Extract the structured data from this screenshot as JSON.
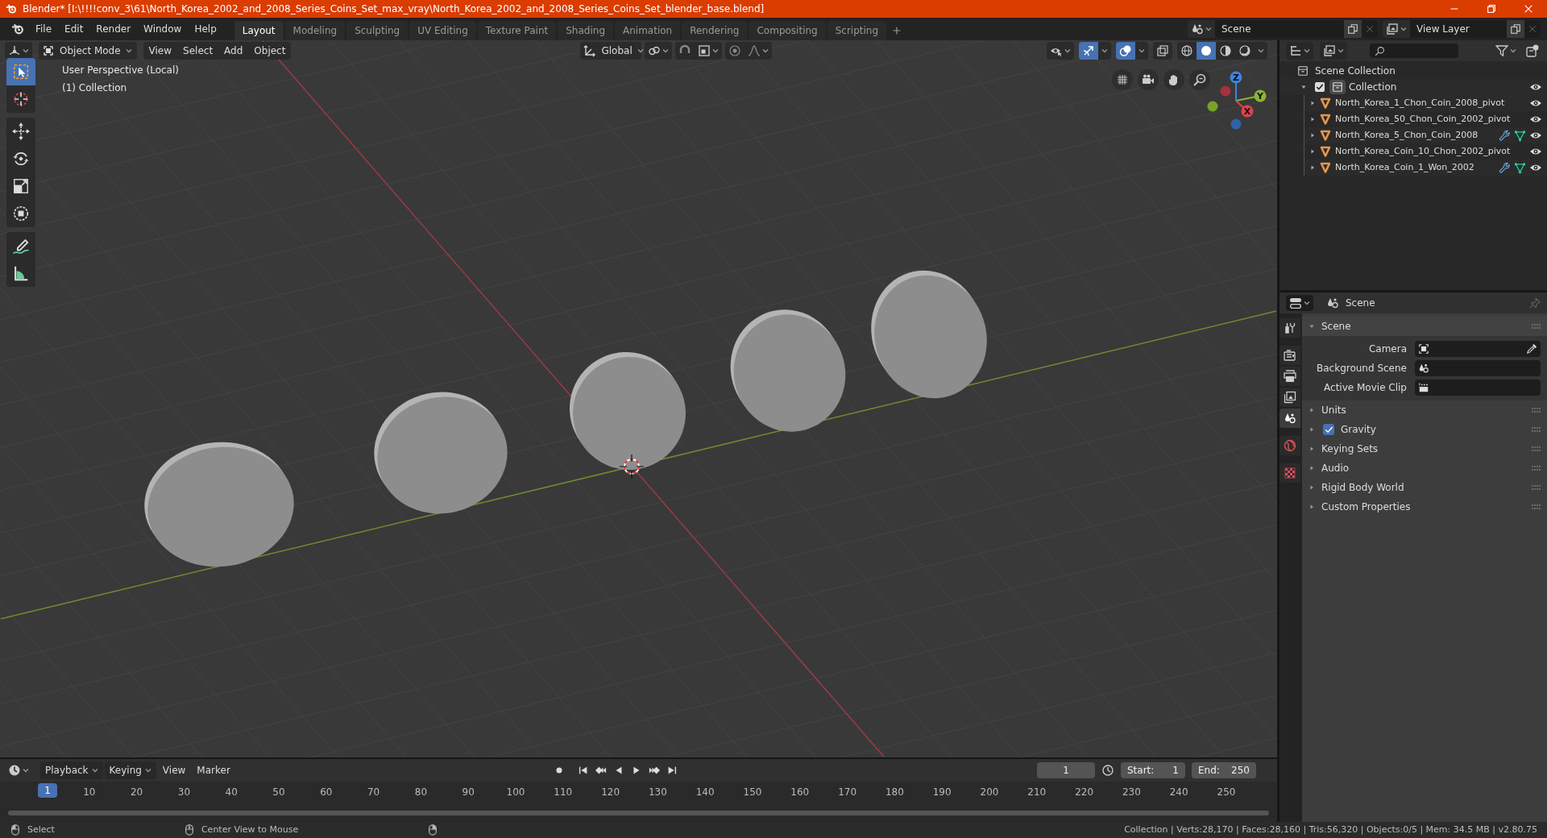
{
  "window": {
    "title": "Blender* [I:\\!!!!conv_3\\61\\North_Korea_2002_and_2008_Series_Coins_Set_max_vray\\North_Korea_2002_and_2008_Series_Coins_Set_blender_base.blend]"
  },
  "menu": [
    "File",
    "Edit",
    "Render",
    "Window",
    "Help"
  ],
  "workspaces": [
    {
      "label": "Layout",
      "selected": true
    },
    {
      "label": "Modeling",
      "selected": false
    },
    {
      "label": "Sculpting",
      "selected": false
    },
    {
      "label": "UV Editing",
      "selected": false
    },
    {
      "label": "Texture Paint",
      "selected": false
    },
    {
      "label": "Shading",
      "selected": false
    },
    {
      "label": "Animation",
      "selected": false
    },
    {
      "label": "Rendering",
      "selected": false
    },
    {
      "label": "Compositing",
      "selected": false
    },
    {
      "label": "Scripting",
      "selected": false
    }
  ],
  "scene_selector": {
    "value": "Scene"
  },
  "view_layer_selector": {
    "value": "View Layer"
  },
  "viewport": {
    "mode": "Object Mode",
    "menus": [
      "View",
      "Select",
      "Add",
      "Object"
    ],
    "orientation": "Global",
    "gizmos_on": true,
    "overlays_on": true,
    "xray_on": false,
    "shading_modes": [
      {
        "kind": "wireframe",
        "selected": false
      },
      {
        "kind": "solid",
        "selected": true
      },
      {
        "kind": "material",
        "selected": false
      },
      {
        "kind": "rendered",
        "selected": false
      }
    ],
    "overlay_text": [
      "User Perspective (Local)",
      "(1) Collection"
    ],
    "tool_groups": [
      {
        "tools": [
          {
            "kind": "select_box",
            "selected": true
          },
          {
            "kind": "cursor",
            "selected": false
          }
        ]
      },
      {
        "tools": [
          {
            "kind": "move",
            "selected": false
          },
          {
            "kind": "rotate",
            "selected": false
          },
          {
            "kind": "scale",
            "selected": false
          },
          {
            "kind": "transform",
            "selected": false
          }
        ]
      },
      {
        "tools": [
          {
            "kind": "annotate",
            "selected": false
          },
          {
            "kind": "measure",
            "selected": false
          }
        ]
      }
    ],
    "gizmo_axes": [
      "X",
      "Y",
      "Z"
    ]
  },
  "outliner": {
    "root": "Scene Collection",
    "items": [
      {
        "label": "Collection",
        "checked": true,
        "expanded": true,
        "children": [
          {
            "label": "North_Korea_1_Chon_Coin_2008_pivot",
            "modifiers": false
          },
          {
            "label": "North_Korea_50_Chon_Coin_2002_pivot",
            "modifiers": false
          },
          {
            "label": "North_Korea_5_Chon_Coin_2008",
            "modifiers": true
          },
          {
            "label": "North_Korea_Coin_10_Chon_2002_pivot",
            "modifiers": false
          },
          {
            "label": "North_Korea_Coin_1_Won_2002",
            "modifiers": true
          }
        ]
      }
    ]
  },
  "properties": {
    "title": "Scene",
    "tabs": [
      {
        "kind": "tool",
        "selected": false
      },
      {
        "kind": "render",
        "selected": false
      },
      {
        "kind": "output",
        "selected": false
      },
      {
        "kind": "view_layer",
        "selected": false
      },
      {
        "kind": "scene",
        "selected": true
      },
      {
        "kind": "world",
        "selected": false
      },
      {
        "kind": "texture",
        "selected": false
      }
    ],
    "panels": [
      {
        "kind": "section",
        "label": "Scene",
        "expanded": true,
        "fields": [
          {
            "kind": "camera",
            "label": "Camera"
          },
          {
            "kind": "scene",
            "label": "Background Scene"
          },
          {
            "kind": "movieclip",
            "label": "Active Movie Clip"
          }
        ]
      },
      {
        "kind": "section",
        "label": "Units",
        "expanded": false
      },
      {
        "kind": "toggle",
        "label": "Gravity",
        "expanded": false,
        "checked": true
      },
      {
        "kind": "section",
        "label": "Keying Sets",
        "expanded": false
      },
      {
        "kind": "section",
        "label": "Audio",
        "expanded": false
      },
      {
        "kind": "section",
        "label": "Rigid Body World",
        "expanded": false
      },
      {
        "kind": "section",
        "label": "Custom Properties",
        "expanded": false
      }
    ]
  },
  "timeline": {
    "menus": [
      {
        "label": "Playback",
        "dropdown": true
      },
      {
        "label": "Keying",
        "dropdown": true
      },
      {
        "label": "View",
        "dropdown": false
      },
      {
        "label": "Marker",
        "dropdown": false
      }
    ],
    "current_frame": "1",
    "start_label": "Start:",
    "start": "1",
    "end_label": "End:",
    "end": "250",
    "playhead": "1",
    "ruler": [
      "10",
      "20",
      "30",
      "40",
      "50",
      "60",
      "70",
      "80",
      "90",
      "100",
      "110",
      "120",
      "130",
      "140",
      "150",
      "160",
      "170",
      "180",
      "190",
      "200",
      "210",
      "220",
      "230",
      "240",
      "250"
    ]
  },
  "status_bar": {
    "hints": [
      {
        "kind": "mouse_left",
        "label": "Select"
      },
      {
        "kind": "mouse_middle",
        "label": "Center View to Mouse"
      },
      {
        "kind": "mouse_right"
      }
    ],
    "stats": "Collection | Verts:28,170 | Faces:28,160 | Tris:56,320 | Objects:0/5 | Mem: 34.5 MB | v2.80.75"
  }
}
